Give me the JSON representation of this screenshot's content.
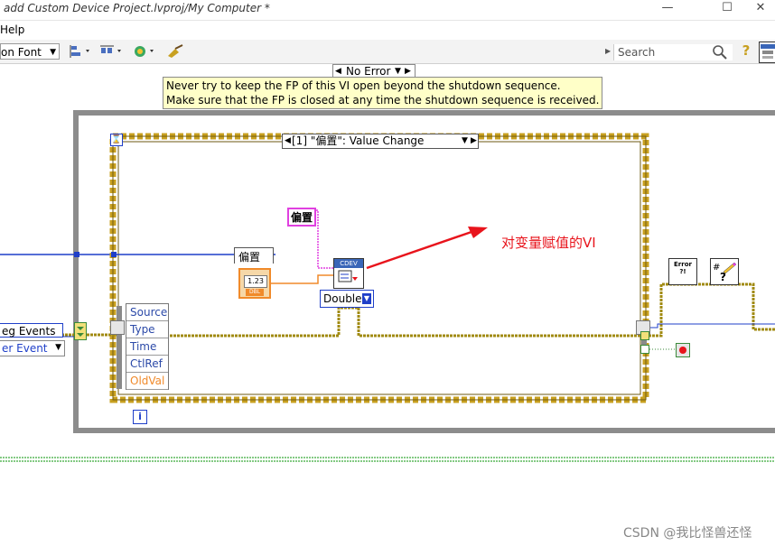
{
  "window": {
    "title": "add Custom Device Project.lvproj/My Computer *",
    "minimize_glyph": "—",
    "maximize_glyph": "☐",
    "close_glyph": "✕"
  },
  "menu": {
    "help": "Help"
  },
  "toolbar": {
    "font_label": "on Font",
    "search_placeholder": "Search",
    "help_glyph": "?",
    "dropdown_glyph": "▾"
  },
  "diagram": {
    "error_case": "No Error",
    "comment_line1": "Never try to keep the FP of this VI open beyond the shutdown sequence.",
    "comment_line2": "Make sure that the FP is closed at any time the shutdown sequence is received.",
    "event_case": "[1] \"偏置\": Value Change",
    "control_label": "偏置",
    "value_label": "偏置",
    "numeric_value": "1.23",
    "numeric_type": "DBL",
    "cdev_label": "CDEV",
    "type_select": "Double",
    "event_terminals": [
      "Source",
      "Type",
      "Time",
      "CtlRef",
      "OldVal"
    ],
    "reg_events": "eg Events",
    "user_event": "er Event",
    "annotation": "对变量赋值的VI",
    "error_icon": "Error ?!",
    "info_glyph": "i",
    "event_glyph": "⌛"
  },
  "watermark": "CSDN @我比怪兽还怪",
  "colors": {
    "blue_wire": "#1f3fc9",
    "orange_wire": "#f08a2a",
    "pink_wire": "#e040e0",
    "cluster_wire": "#a08a10",
    "event_border": "#c8a020",
    "while_loop": "#8c8c8c",
    "annotation_red": "#e8141c",
    "green_wire": "#5cb85c"
  }
}
